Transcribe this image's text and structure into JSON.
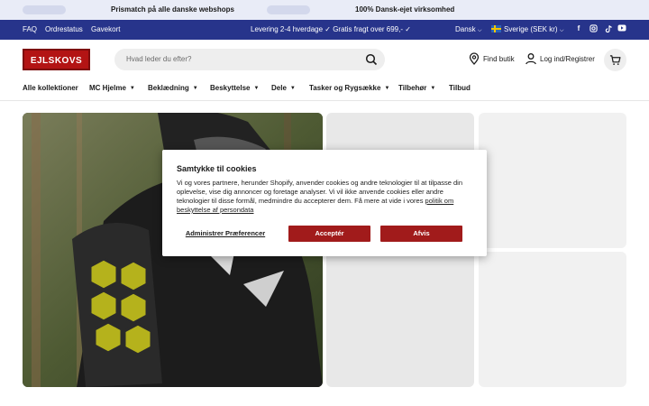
{
  "announcement": {
    "items": [
      "Prismatch på alle danske webshops",
      "100% Dansk-ejet virksomhed"
    ]
  },
  "topbar": {
    "links": [
      "FAQ",
      "Ordrestatus",
      "Gavekort"
    ],
    "message": "Levering 2-4 hverdage  ✓ Gratis fragt over 699,- ✓",
    "language": "Dansk",
    "country": "Sverige (SEK kr)",
    "social": [
      "facebook-icon",
      "instagram-icon",
      "tiktok-icon",
      "youtube-icon"
    ]
  },
  "header": {
    "logo": "EJLSKOVS",
    "search_placeholder": "Hvad leder du efter?",
    "find_store": "Find butik",
    "login": "Log ind/Registrer"
  },
  "nav": {
    "items": [
      {
        "label": "Alle kollektioner",
        "dropdown": false
      },
      {
        "label": "MC Hjelme",
        "dropdown": true
      },
      {
        "label": "Beklædning",
        "dropdown": true
      },
      {
        "label": "Beskyttelse",
        "dropdown": true
      },
      {
        "label": "Dele",
        "dropdown": true
      },
      {
        "label": "Tasker og Rygsække",
        "dropdown": true
      },
      {
        "label": "Tilbehør",
        "dropdown": true
      },
      {
        "label": "Tilbud",
        "dropdown": false
      }
    ]
  },
  "cookie": {
    "title": "Samtykke til cookies",
    "body": "Vi og vores partnere, herunder Shopify, anvender cookies og andre teknologier til at tilpasse din oplevelse, vise dig annoncer og foretage analyser. Vi vil ikke anvende cookies eller andre teknologier til disse formål, medmindre du accepterer dem. Få mere at vide i vores ",
    "link": "politik om beskyttelse af persondata",
    "preferences": "Administrer Præferencer",
    "accept": "Acceptér",
    "decline": "Afvis"
  },
  "colors": {
    "brand_red": "#b31414",
    "topbar_blue": "#27348b",
    "button_red": "#a11b1b"
  }
}
